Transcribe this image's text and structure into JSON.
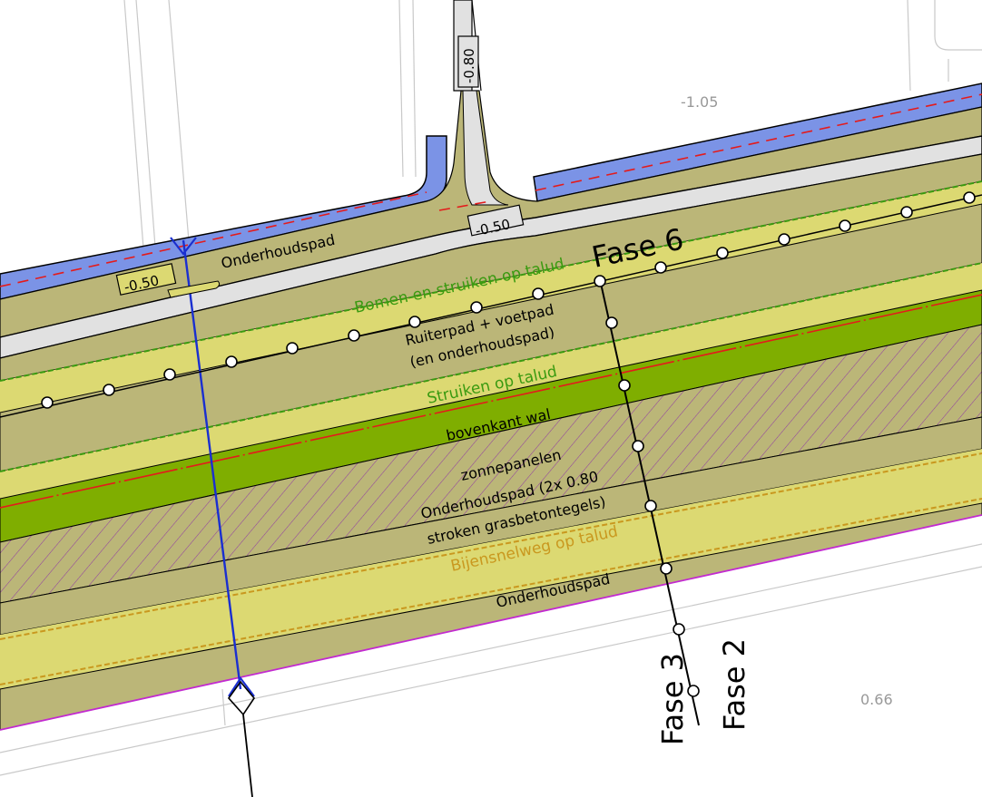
{
  "colors": {
    "khaki": "#bbb678",
    "yellow_band": "#dcd972",
    "green_band": "#7fae00",
    "blue_water": "#7b93e6",
    "road_gray": "#e1e1e1",
    "label_green": "#3a9a10",
    "label_ochre": "#c9981f",
    "red_dash": "#e41b1b",
    "blue_line": "#1a2fd0",
    "magenta_line": "#c22ad0"
  },
  "levels": {
    "top_right": "-1.05",
    "bottom_right": "0.66",
    "stem": "-0.80",
    "junction": "-0.50",
    "left": "-0.50"
  },
  "labels": {
    "onderhoudspad_top": "Onderhoudspad",
    "fase6": "Fase 6",
    "bomen": "Bomen en struiken op talud",
    "ruiterpad_1": "Ruiterpad + voetpad",
    "ruiterpad_2": "(en onderhoudspad)",
    "struiken": "Struiken op talud",
    "bovenkant": "bovenkant wal",
    "zonnepanelen": "zonnepanelen",
    "onderhoudspad_2x_1": "Onderhoudspad (2x 0.80",
    "onderhoudspad_2x_2": "stroken grasbetontegels)",
    "bijen": "Bijensnelweg op talud",
    "onderhoudspad_bottom": "Onderhoudspad",
    "fase3": "Fase 3",
    "fase2": "Fase 2"
  }
}
